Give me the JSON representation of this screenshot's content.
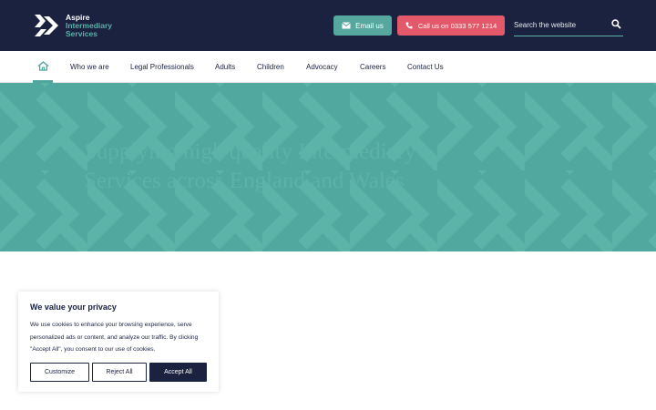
{
  "colors": {
    "navy": "#1a2240",
    "teal": "#51a89e",
    "coral": "#e4596a",
    "white": "#ffffff"
  },
  "header": {
    "logo_icon": "aspire-chevrons-logo",
    "logo_line1": "Aspire",
    "logo_line2": "Intermediary",
    "logo_line3": "Services",
    "email_icon": "envelope-icon",
    "email_label": "Email us",
    "call_icon": "phone-icon",
    "call_label": "Call us on 0333 577 1214",
    "search_placeholder": "Search the website",
    "search_icon": "search-icon"
  },
  "nav": {
    "home_icon": "home-icon",
    "items": [
      "Who we are",
      "Legal Professionals",
      "Adults",
      "Children",
      "Advocacy",
      "Careers",
      "Contact Us"
    ]
  },
  "hero": {
    "title": "Supplying high quality Intermediary Services across England and Wales"
  },
  "cookie": {
    "title": "We value your privacy",
    "text": "We use cookies to enhance your browsing experience, serve personalized ads or content, and analyze our traffic. By clicking \"Accept All\", you consent to our use of cookies.",
    "customize": "Customize",
    "reject": "Reject All",
    "accept": "Accept All"
  }
}
